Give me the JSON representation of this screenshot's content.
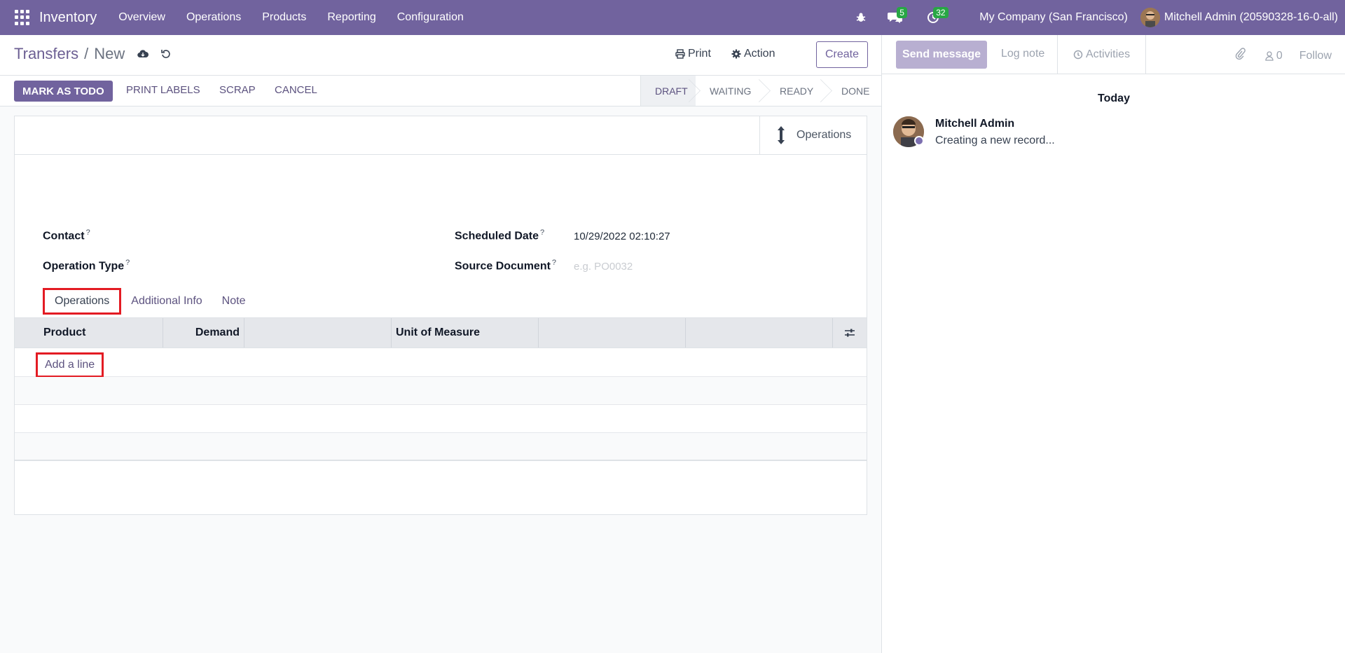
{
  "navbar": {
    "app_name": "Inventory",
    "menu": [
      "Overview",
      "Operations",
      "Products",
      "Reporting",
      "Configuration"
    ],
    "messages_count": "5",
    "activities_count": "32",
    "company": "My Company (San Francisco)",
    "user": "Mitchell Admin (20590328-16-0-all)"
  },
  "control_panel": {
    "breadcrumb_parent": "Transfers",
    "breadcrumb_sep": "/",
    "breadcrumb_current": "New",
    "print_label": "Print",
    "action_label": "Action",
    "create_label": "Create"
  },
  "status_bar": {
    "mark_todo": "MARK AS TODO",
    "print_labels": "PRINT LABELS",
    "scrap": "SCRAP",
    "cancel": "CANCEL",
    "stages": [
      "DRAFT",
      "WAITING",
      "READY",
      "DONE"
    ],
    "active_stage": "DRAFT"
  },
  "sheet": {
    "stat_button_label": "Operations",
    "contact_label": "Contact",
    "operation_type_label": "Operation Type",
    "scheduled_date_label": "Scheduled Date",
    "scheduled_date_value": "10/29/2022 02:10:27",
    "source_document_label": "Source Document",
    "source_document_placeholder": "e.g. PO0032",
    "help_mark": "?",
    "tabs": [
      "Operations",
      "Additional Info",
      "Note"
    ],
    "table_headers": [
      "Product",
      "Demand",
      "Unit of Measure"
    ],
    "add_line": "Add a line"
  },
  "chatter": {
    "send_message": "Send message",
    "log_note": "Log note",
    "activities": "Activities",
    "followers_count": "0",
    "follow": "Follow",
    "today": "Today",
    "author": "Mitchell Admin",
    "message": "Creating a new record..."
  },
  "colors": {
    "brand": "#71639e",
    "badge": "#28a745",
    "highlight": "#e31b23"
  }
}
